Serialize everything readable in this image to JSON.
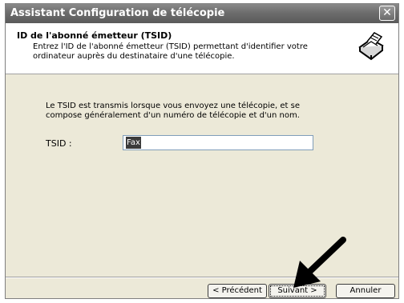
{
  "window": {
    "title": "Assistant Configuration de télécopie"
  },
  "header": {
    "title": "ID de l'abonné émetteur (TSID)",
    "description": "Entrez l'ID de l'abonné émetteur (TSID) permettant d'identifier votre ordinateur auprès du destinataire d'une télécopie.",
    "icon": "fax-machine-icon"
  },
  "body": {
    "info_text": "Le TSID est transmis lorsque vous envoyez une télécopie, et se compose généralement d'un numéro de télécopie et d'un nom.",
    "tsid_label": "TSID :",
    "tsid_value": "Fax"
  },
  "buttons": {
    "prev": "< Précédent",
    "next": "Suivant >",
    "cancel": "Annuler"
  },
  "annotation": {
    "icon": "pointer-arrow-icon"
  }
}
